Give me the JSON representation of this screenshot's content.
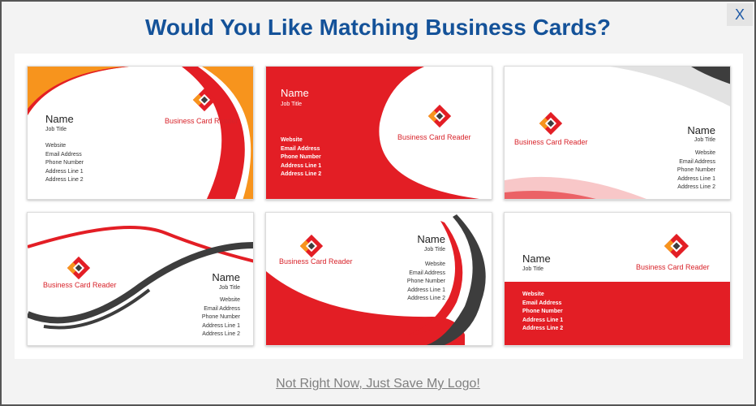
{
  "modal": {
    "title": "Would You Like Matching Business Cards?",
    "close_label": "X",
    "skip_label": "Not Right Now, Just Save My Logo!"
  },
  "card_text": {
    "name": "Name",
    "job_title": "Job Title",
    "brand": "Business Card Reader",
    "lines": [
      "Website",
      "Email Address",
      "Phone Number",
      "Address Line 1",
      "Address Line 2"
    ]
  },
  "colors": {
    "title": "#145299",
    "accent_red": "#e31e25",
    "accent_orange": "#f7941d",
    "dark_gray": "#3d3d3d",
    "link_gray": "#808080"
  },
  "icons": {
    "logo": "red-orange-diamond-logo-icon",
    "close": "close-icon"
  }
}
